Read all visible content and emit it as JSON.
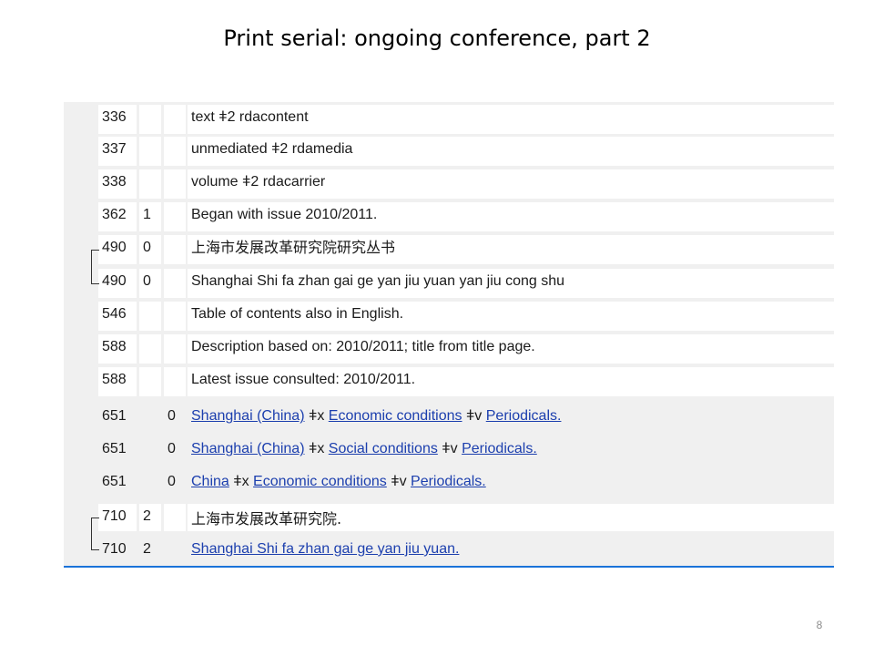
{
  "slide": {
    "title": "Print serial: ongoing conference, part 2",
    "page_number": "8"
  },
  "fields": [
    {
      "tag": "336",
      "ind1": "",
      "ind2": "",
      "text": "text ǂ2 rdacontent"
    },
    {
      "tag": "337",
      "ind1": "",
      "ind2": "",
      "text": "unmediated ǂ2 rdamedia"
    },
    {
      "tag": "338",
      "ind1": "",
      "ind2": "",
      "text": "volume ǂ2 rdacarrier"
    },
    {
      "tag": "362",
      "ind1": "1",
      "ind2": "",
      "text": "Began with issue 2010/2011."
    },
    {
      "tag": "490",
      "ind1": "0",
      "ind2": "",
      "text": "上海市发展改革研究院研究丛书"
    },
    {
      "tag": "490",
      "ind1": "0",
      "ind2": "",
      "text": "Shanghai Shi fa zhan gai ge yan jiu yuan yan jiu cong shu"
    },
    {
      "tag": "546",
      "ind1": "",
      "ind2": "",
      "text": "Table of contents also in English."
    },
    {
      "tag": "588",
      "ind1": "",
      "ind2": "",
      "text": "Description based on: 2010/2011; title from title page."
    },
    {
      "tag": "588",
      "ind1": "",
      "ind2": "",
      "text": "Latest issue consulted: 2010/2011."
    },
    {
      "tag": "651",
      "ind1": "",
      "ind2": "0",
      "parts": [
        "Shanghai (China)",
        " ǂx ",
        "Economic conditions",
        " ǂv ",
        "Periodicals."
      ]
    },
    {
      "tag": "651",
      "ind1": "",
      "ind2": "0",
      "parts": [
        "Shanghai (China)",
        " ǂx ",
        "Social conditions",
        " ǂv ",
        "Periodicals."
      ]
    },
    {
      "tag": "651",
      "ind1": "",
      "ind2": "0",
      "parts": [
        "China",
        " ǂx ",
        "Economic conditions",
        " ǂv ",
        "Periodicals."
      ]
    },
    {
      "tag": "710",
      "ind1": "2",
      "ind2": "",
      "text": "上海市发展改革研究院."
    },
    {
      "tag": "710",
      "ind1": "2",
      "ind2": "",
      "link": "Shanghai Shi fa zhan gai ge yan jiu yuan."
    }
  ]
}
